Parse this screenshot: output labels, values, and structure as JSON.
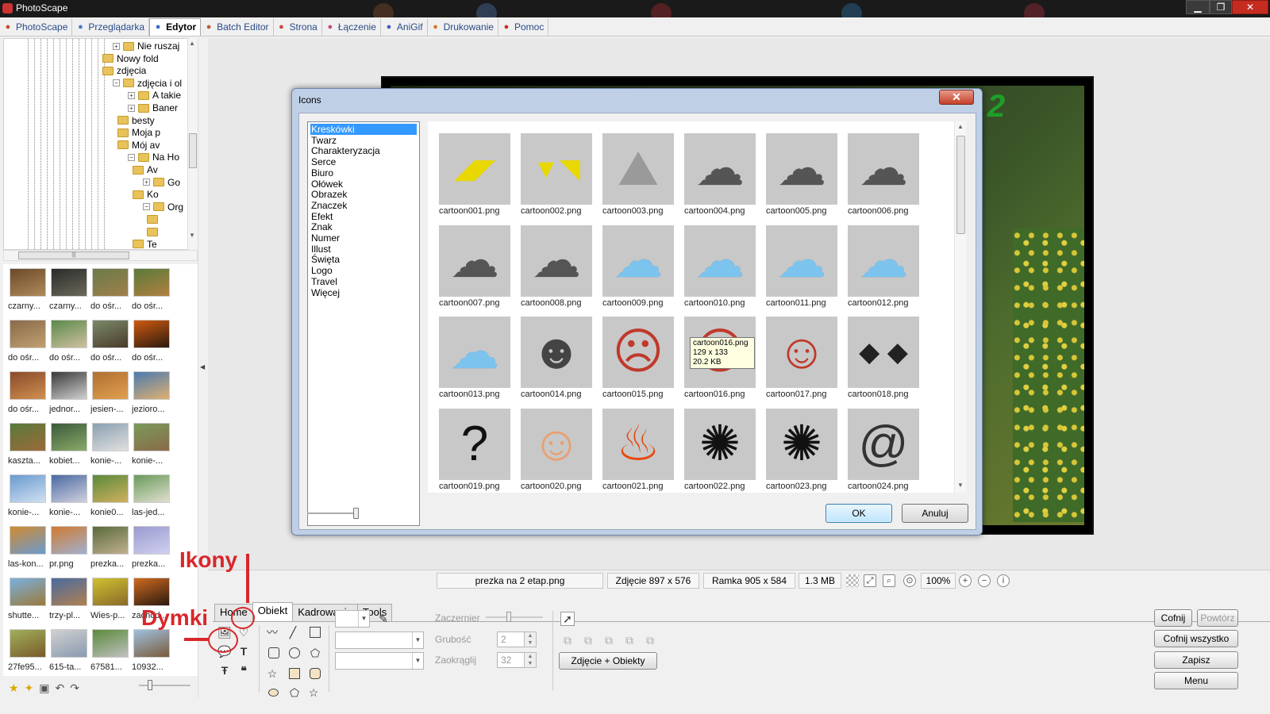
{
  "window": {
    "title": "PhotoScape",
    "minimize": "▁",
    "maximize": "❐",
    "close": "✕"
  },
  "menu": [
    {
      "label": "PhotoScape",
      "icon": "photoscape-icon",
      "color": "#c94a2a"
    },
    {
      "label": "Przeglądarka",
      "icon": "viewer-icon",
      "color": "#4a7bc4"
    },
    {
      "label": "Edytor",
      "icon": "editor-icon",
      "color": "#3a6cc0",
      "active": true
    },
    {
      "label": "Batch Editor",
      "icon": "batch-editor-icon",
      "color": "#c0593a"
    },
    {
      "label": "Strona",
      "icon": "page-icon",
      "color": "#d0463a"
    },
    {
      "label": "Łączenie",
      "icon": "combine-icon",
      "color": "#c04a8a"
    },
    {
      "label": "AniGif",
      "icon": "anigif-icon",
      "color": "#4a5ac0"
    },
    {
      "label": "Drukowanie",
      "icon": "print-icon",
      "color": "#d07a2a"
    },
    {
      "label": "Pomoc",
      "icon": "help-icon",
      "color": "#d02a2a"
    }
  ],
  "tree": {
    "nodes": [
      {
        "label": "Nie ruszaj",
        "expander": "+"
      },
      {
        "label": "Nowy fold",
        "expander": ""
      },
      {
        "label": "zdjęcia",
        "expander": ""
      },
      {
        "label": "zdjęcia i ol",
        "expander": "−"
      },
      {
        "label": "A takie",
        "expander": "+"
      },
      {
        "label": "Baner",
        "expander": "+"
      },
      {
        "label": "besty",
        "expander": ""
      },
      {
        "label": "Moja p",
        "expander": ""
      },
      {
        "label": "Mój av",
        "expander": ""
      },
      {
        "label": "Na Ho",
        "expander": "−"
      },
      {
        "label": "Av",
        "expander": ""
      },
      {
        "label": "Go",
        "expander": "+"
      },
      {
        "label": "Ko",
        "expander": ""
      },
      {
        "label": "Org",
        "expander": "−"
      },
      {
        "label": "",
        "expander": ""
      },
      {
        "label": "",
        "expander": ""
      },
      {
        "label": "Te",
        "expander": ""
      }
    ],
    "hscroll_grip": "|||"
  },
  "thumbnails": [
    {
      "name": "czarny...",
      "c1": "#6b4a2a",
      "c2": "#b08a5a"
    },
    {
      "name": "czarny...",
      "c1": "#2a2a2a",
      "c2": "#6a6a5a"
    },
    {
      "name": "do ośr...",
      "c1": "#6a7a4a",
      "c2": "#a0804a"
    },
    {
      "name": "do ośr...",
      "c1": "#5a7a3a",
      "c2": "#b08040"
    },
    {
      "name": "do ośr...",
      "c1": "#8a6a4a",
      "c2": "#c0a070"
    },
    {
      "name": "do ośr...",
      "c1": "#5a8a4a",
      "c2": "#d0c0a0"
    },
    {
      "name": "do ośr...",
      "c1": "#7a8a6a",
      "c2": "#4a3a2a"
    },
    {
      "name": "do ośr...",
      "c1": "#d05a10",
      "c2": "#2a1a10"
    },
    {
      "name": "do ośr...",
      "c1": "#8a4a2a",
      "c2": "#d09050"
    },
    {
      "name": "jednor...",
      "c1": "#3a3a3a",
      "c2": "#d0d0d0"
    },
    {
      "name": "jesien-...",
      "c1": "#b07030",
      "c2": "#e0a050"
    },
    {
      "name": "jezioro...",
      "c1": "#4a7ab0",
      "c2": "#e0b070"
    },
    {
      "name": "kaszta...",
      "c1": "#5a7a3a",
      "c2": "#9a6a3a"
    },
    {
      "name": "kobiet...",
      "c1": "#3a5a3a",
      "c2": "#8aaa6a"
    },
    {
      "name": "konie-...",
      "c1": "#8aa0b0",
      "c2": "#e0e0e0"
    },
    {
      "name": "konie-...",
      "c1": "#7a9a5a",
      "c2": "#8a6a4a"
    },
    {
      "name": "konie-...",
      "c1": "#6a9ad0",
      "c2": "#d0e0f0"
    },
    {
      "name": "konie-...",
      "c1": "#4a6aa0",
      "c2": "#d0d0e0"
    },
    {
      "name": "konie0...",
      "c1": "#5a8a3a",
      "c2": "#d0b060"
    },
    {
      "name": "las-jed...",
      "c1": "#6a9a5a",
      "c2": "#e0e0d0"
    },
    {
      "name": "las-kon...",
      "c1": "#d08a30",
      "c2": "#6a9ad0"
    },
    {
      "name": "pr.png",
      "c1": "#d07a30",
      "c2": "#a0b0d0"
    },
    {
      "name": "prezka...",
      "c1": "#5a6a3a",
      "c2": "#c0b090"
    },
    {
      "name": "prezka...",
      "c1": "#9a9ad0",
      "c2": "#d0d0f0"
    },
    {
      "name": "shutte...",
      "c1": "#7ab0e0",
      "c2": "#9a7a3a"
    },
    {
      "name": "trzy-pl...",
      "c1": "#4a6aa0",
      "c2": "#b08050"
    },
    {
      "name": "Wies-p...",
      "c1": "#d0c030",
      "c2": "#8a6a2a"
    },
    {
      "name": "zachód...",
      "c1": "#d06a20",
      "c2": "#2a1a10"
    },
    {
      "name": "27fe95...",
      "c1": "#a0b05a",
      "c2": "#7a5a2a"
    },
    {
      "name": "615-ta...",
      "c1": "#d0d0d0",
      "c2": "#8a9ab0"
    },
    {
      "name": "67581...",
      "c1": "#5a8a3a",
      "c2": "#c0c0c0"
    },
    {
      "name": "10932...",
      "c1": "#a0c0e0",
      "c2": "#7a5a3a"
    }
  ],
  "left_toolbar": {
    "icons": [
      "star-icon",
      "star-plus-icon",
      "folder-icon",
      "back-arrow-icon",
      "forward-arrow-icon"
    ],
    "glyphs": [
      "★",
      "✦",
      "▣",
      "↶",
      "↷"
    ]
  },
  "status": {
    "filename": "prezka na 2 etap.png",
    "photo": "Zdjęcie 897 x 576",
    "frame": "Ramka 905 x 584",
    "size": "1.3 MB",
    "zoom": "100%"
  },
  "editor_tabs": [
    "Home",
    "Obiekt",
    "Kadrowanie",
    "Tools"
  ],
  "editor_active_tab": 1,
  "editor": {
    "opacity_label": "Zaczernier",
    "thickness_label": "Grubość",
    "thickness_value": "2",
    "round_label": "Zaokrąglij",
    "round_value": "32",
    "photo_objects_button": "Zdjęcie + Obiekty"
  },
  "right_buttons": {
    "undo": "Cofnij",
    "redo": "Powtórz",
    "undo_all": "Cofnij wszystko",
    "save": "Zapisz",
    "menu": "Menu"
  },
  "dialog": {
    "title": "Icons",
    "close": "✕",
    "categories": [
      "Kreskówki",
      "Twarz",
      "Charakteryzacja",
      "Serce",
      "Biuro",
      "Ołówek",
      "Obrazek",
      "Znaczek",
      "Efekt",
      "Znak",
      "Numer",
      "Illust",
      "Święta",
      "Logo",
      "Travel",
      "Więcej"
    ],
    "selected_category": 0,
    "icons": [
      {
        "file": "cartoon001.png",
        "icon": "yellow-spark-icon",
        "glyph": "◢◤",
        "color": "#e8d800"
      },
      {
        "file": "cartoon002.png",
        "icon": "yellow-burst-icon",
        "glyph": "▼◥",
        "color": "#e8d800"
      },
      {
        "file": "cartoon003.png",
        "icon": "rock-crash-icon",
        "glyph": "⛰",
        "color": "#9a9a9a"
      },
      {
        "file": "cartoon004.png",
        "icon": "rain-cloud-icon",
        "glyph": "☁",
        "color": "#555555"
      },
      {
        "file": "cartoon005.png",
        "icon": "snow-cloud-icon",
        "glyph": "☁",
        "color": "#555555"
      },
      {
        "file": "cartoon006.png",
        "icon": "drizzle-cloud-icon",
        "glyph": "☁",
        "color": "#555555"
      },
      {
        "file": "cartoon007.png",
        "icon": "dark-cloud-icon",
        "glyph": "☁",
        "color": "#555555"
      },
      {
        "file": "cartoon008.png",
        "icon": "storm-cloud-icon",
        "glyph": "☁",
        "color": "#555555"
      },
      {
        "file": "cartoon009.png",
        "icon": "blue-cloud-icon",
        "glyph": "☁",
        "color": "#7cc4ee"
      },
      {
        "file": "cartoon010.png",
        "icon": "blue-cloud-icon",
        "glyph": "☁",
        "color": "#7cc4ee"
      },
      {
        "file": "cartoon011.png",
        "icon": "blue-cloud-icon",
        "glyph": "☁",
        "color": "#7cc4ee"
      },
      {
        "file": "cartoon012.png",
        "icon": "blue-cloud-icon",
        "glyph": "☁",
        "color": "#7cc4ee"
      },
      {
        "file": "cartoon013.png",
        "icon": "flat-blue-cloud-icon",
        "glyph": "☁",
        "color": "#7cc4ee"
      },
      {
        "file": "cartoon014.png",
        "icon": "robot-face-icon",
        "glyph": "☻",
        "color": "#444444"
      },
      {
        "file": "cartoon015.png",
        "icon": "scared-face-icon",
        "glyph": "☹",
        "color": "#c0392b"
      },
      {
        "file": "cartoon016.png",
        "icon": "angry-face-icon",
        "glyph": "☹",
        "color": "#c0392b"
      },
      {
        "file": "cartoon017.png",
        "icon": "shouting-face-icon",
        "glyph": "☺",
        "color": "#c0392b"
      },
      {
        "file": "cartoon018.png",
        "icon": "blushing-eyes-icon",
        "glyph": "◆ ◆",
        "color": "#222222"
      },
      {
        "file": "cartoon019.png",
        "icon": "question-bubble-icon",
        "glyph": "?",
        "color": "#111111"
      },
      {
        "file": "cartoon020.png",
        "icon": "laughing-face-icon",
        "glyph": "☺",
        "color": "#e8a070"
      },
      {
        "file": "cartoon021.png",
        "icon": "fire-icon",
        "glyph": "♨",
        "color": "#e84a10"
      },
      {
        "file": "cartoon022.png",
        "icon": "white-splat-icon",
        "glyph": "✺",
        "color": "#111111"
      },
      {
        "file": "cartoon023.png",
        "icon": "scribble-icon",
        "glyph": "✺",
        "color": "#111111"
      },
      {
        "file": "cartoon024.png",
        "icon": "spiral-icon",
        "glyph": "@",
        "color": "#333333"
      }
    ],
    "tooltip": {
      "name": "cartoon016.png",
      "dims": "129 x 133",
      "size": "20.2 KB"
    },
    "ok": "OK",
    "cancel": "Anuluj"
  },
  "annotations": {
    "icons": "Ikony",
    "bubbles": "Dymki",
    "color": "#d9262a"
  }
}
